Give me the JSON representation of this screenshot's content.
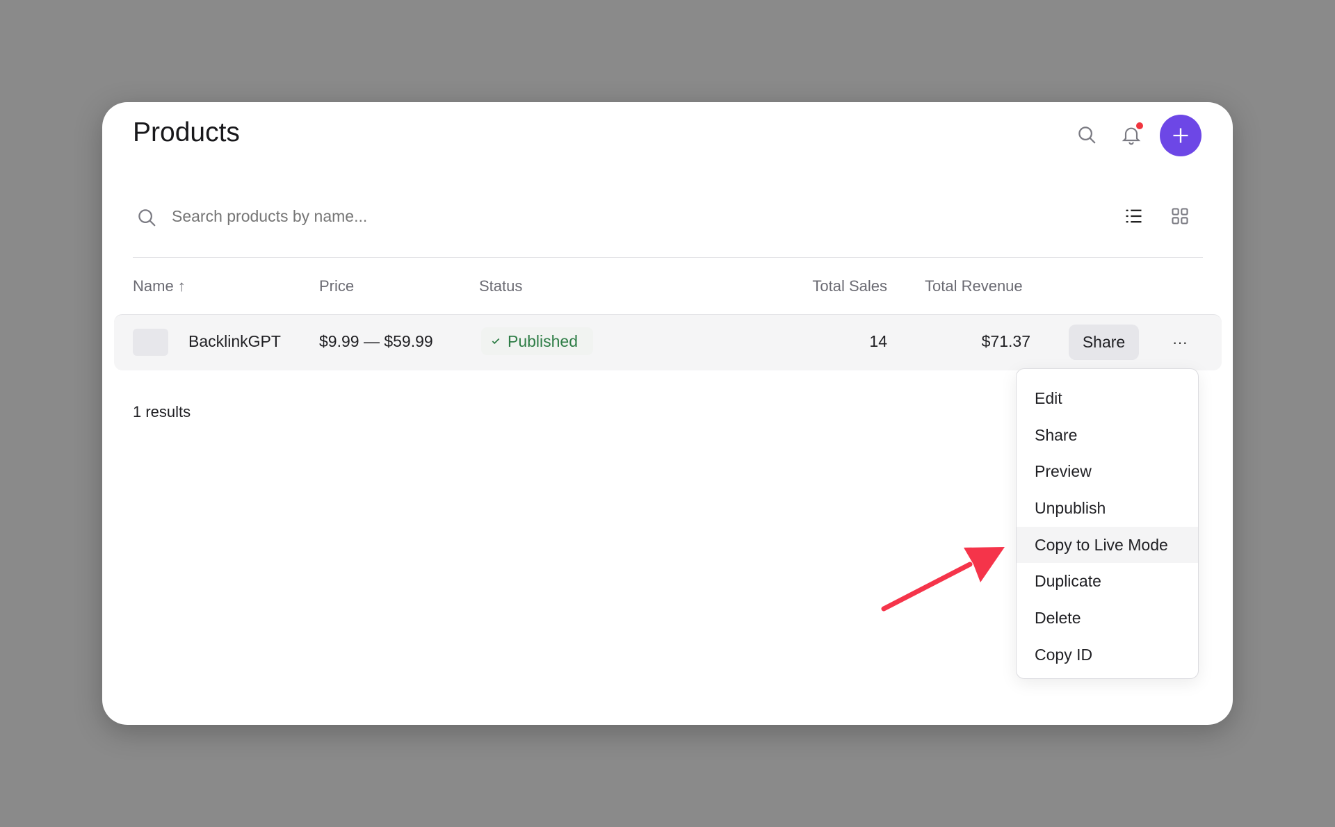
{
  "header": {
    "title": "Products",
    "icons": [
      "search-icon",
      "bell-icon",
      "plus-icon"
    ],
    "notification_dot_color": "#f0353f",
    "accent": "#6d47e6"
  },
  "search": {
    "placeholder": "Search products by name...",
    "view_icons": [
      "list-view-icon",
      "grid-view-icon"
    ]
  },
  "table": {
    "columns": [
      "Name ↑",
      "Price",
      "Status",
      "Total Sales",
      "Total Revenue"
    ],
    "rows": [
      {
        "name": "BacklinkGPT",
        "price": "$9.99 — $59.99",
        "status": "Published",
        "total_sales": "14",
        "total_revenue": "$71.37",
        "share_label": "Share"
      }
    ]
  },
  "results_count": "1 results",
  "menu": {
    "items": [
      "Edit",
      "Share",
      "Preview",
      "Unpublish",
      "Copy to Live Mode",
      "Duplicate",
      "Delete",
      "Copy ID"
    ],
    "highlighted": "Copy to Live Mode"
  },
  "annotation": {
    "arrow_color": "#f5344a"
  }
}
